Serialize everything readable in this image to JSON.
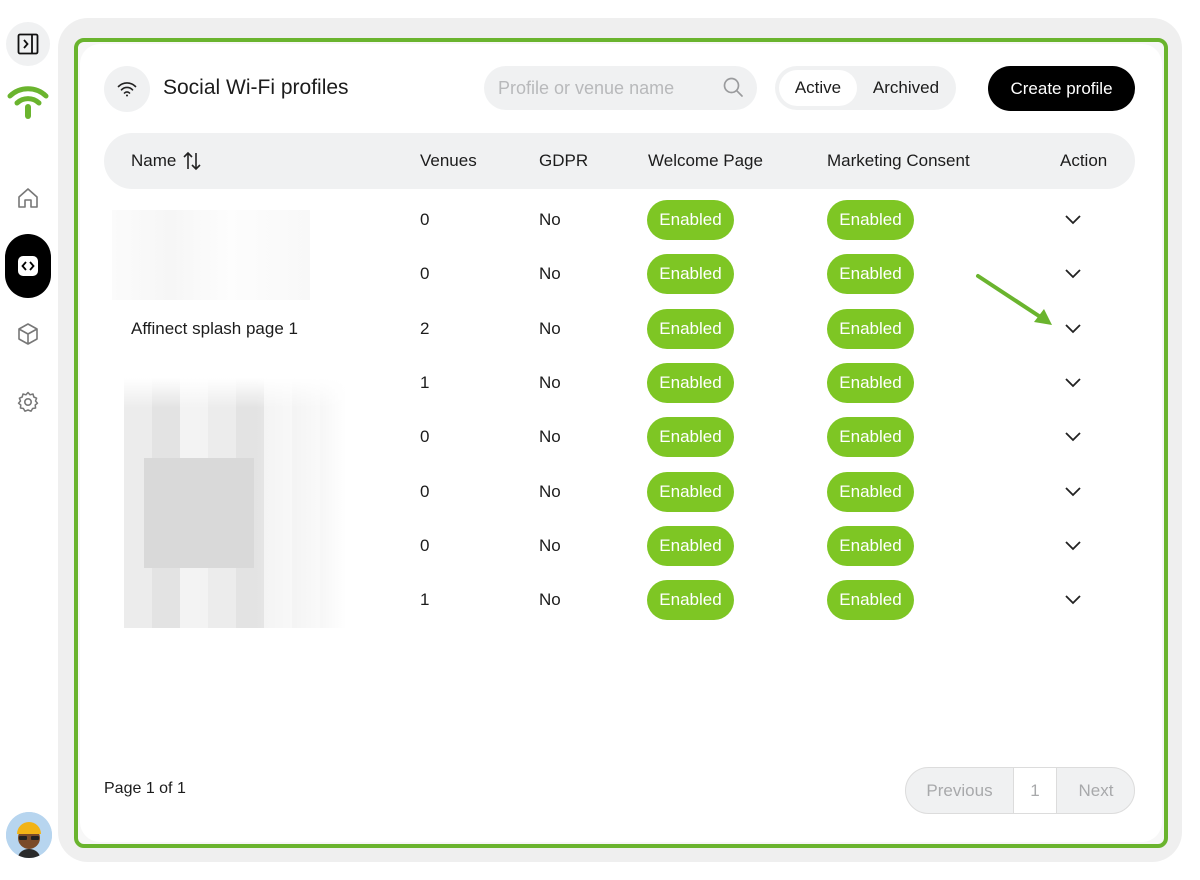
{
  "header": {
    "title": "Social Wi-Fi profiles",
    "search_placeholder": "Profile or venue name",
    "filter_active": "Active",
    "filter_archived": "Archived",
    "create_label": "Create profile"
  },
  "icons": {
    "rail_toggle": "sidebar-toggle-icon",
    "logo": "wifi-logo-icon",
    "nav": [
      "home-icon",
      "code-icon",
      "cube-icon",
      "gear-icon"
    ],
    "active_nav": "code-icon",
    "header": "wifi-icon",
    "search": "search-icon",
    "sort": "sort-icon",
    "row_action": "chevron-down-icon"
  },
  "colors": {
    "brand": "#6ab42e",
    "badge": "#7ec624",
    "primary_button": "#000000",
    "pill_bg": "#f0f1f2"
  },
  "table": {
    "columns": [
      "Name",
      "Venues",
      "GDPR",
      "Welcome Page",
      "Marketing Consent",
      "Action"
    ],
    "rows": [
      {
        "name": "",
        "venues": "0",
        "gdpr": "No",
        "welcome": "Enabled",
        "marketing": "Enabled"
      },
      {
        "name": "",
        "venues": "0",
        "gdpr": "No",
        "welcome": "Enabled",
        "marketing": "Enabled"
      },
      {
        "name": "Affinect splash page 1",
        "venues": "2",
        "gdpr": "No",
        "welcome": "Enabled",
        "marketing": "Enabled"
      },
      {
        "name": "",
        "venues": "1",
        "gdpr": "No",
        "welcome": "Enabled",
        "marketing": "Enabled"
      },
      {
        "name": "",
        "venues": "0",
        "gdpr": "No",
        "welcome": "Enabled",
        "marketing": "Enabled"
      },
      {
        "name": "",
        "venues": "0",
        "gdpr": "No",
        "welcome": "Enabled",
        "marketing": "Enabled"
      },
      {
        "name": "",
        "venues": "0",
        "gdpr": "No",
        "welcome": "Enabled",
        "marketing": "Enabled"
      },
      {
        "name": "",
        "venues": "1",
        "gdpr": "No",
        "welcome": "Enabled",
        "marketing": "Enabled"
      }
    ]
  },
  "pagination": {
    "info": "Page 1 of 1",
    "previous": "Previous",
    "current": "1",
    "next": "Next"
  }
}
